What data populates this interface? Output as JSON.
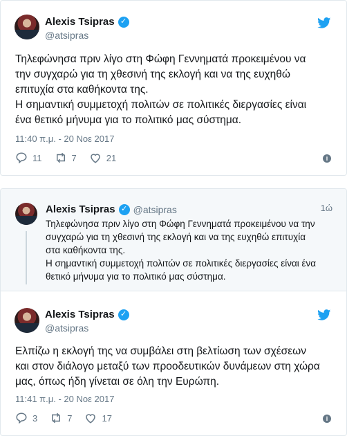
{
  "tweet1": {
    "author_name": "Alexis Tsipras",
    "author_handle": "@atsipras",
    "verified_mark": "✓",
    "text": "Τηλεφώνησα πριν λίγο στη Φώφη Γεννηματά προκειμένου να\nτην συγχαρώ για τη χθεσινή της εκλογή και να της ευχηθώ\nεπιτυχία στα καθήκοντα της.\nΗ σημαντική συμμετοχή πολιτών σε πολιτικές διεργασίες είναι\nένα θετικό μήνυμα για το πολιτικό μας σύστημα.",
    "timestamp": "11:40 π.μ. - 20 Νοε 2017",
    "replies": "11",
    "retweets": "7",
    "likes": "21"
  },
  "tweet2": {
    "parent": {
      "author_name": "Alexis Tsipras",
      "author_handle": "@atsipras",
      "verified_mark": "✓",
      "time_ago": "1ώ",
      "text": "Τηλεφώνησα πριν λίγο στη Φώφη Γεννηματά προκειμένου να την\nσυγχαρώ για τη χθεσινή της εκλογή και να της ευχηθώ επιτυχία\nστα καθήκοντα της.\nΗ σημαντική συμμετοχή πολιτών σε πολιτικές διεργασίες είναι ένα\nθετικό μήνυμα για το πολιτικό μας σύστημα."
    },
    "author_name": "Alexis Tsipras",
    "author_handle": "@atsipras",
    "verified_mark": "✓",
    "text": "Ελπίζω η εκλογή της να συμβάλει στη βελτίωση των σχέσεων\nκαι στον διάλογο μεταξύ των προοδευτικών δυνάμεων στη χώρα\nμας, όπως ήδη γίνεται σε όλη την Ευρώπη.",
    "timestamp": "11:41 π.μ. - 20 Νοε 2017",
    "replies": "3",
    "retweets": "7",
    "likes": "17"
  },
  "colors": {
    "twitter_blue": "#1da1f2",
    "secondary_text": "#657786",
    "border": "#e1e8ed"
  },
  "icons": [
    "twitter-bird-icon",
    "verified-icon",
    "reply-icon",
    "retweet-icon",
    "like-icon",
    "info-icon"
  ],
  "info_glyph": "i"
}
